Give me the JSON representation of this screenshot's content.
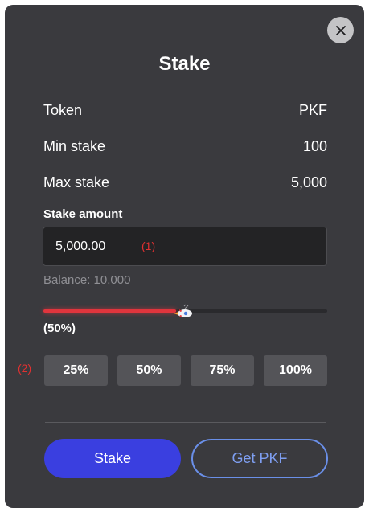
{
  "modal": {
    "title": "Stake",
    "close_icon": "close-icon"
  },
  "info": [
    {
      "label": "Token",
      "value": "PKF"
    },
    {
      "label": "Min stake",
      "value": "100"
    },
    {
      "label": "Max stake",
      "value": "5,000"
    }
  ],
  "stake_amount": {
    "label": "Stake amount",
    "value": "5,000.00",
    "annotation": "(1)"
  },
  "balance": "Balance: 10,000",
  "slider": {
    "fraction": 0.5,
    "readout": "(50%)",
    "thumb_icon": "rocket-icon",
    "fill_color": "#e0353d"
  },
  "percent_buttons": {
    "annotation": "(2)",
    "items": [
      "25%",
      "50%",
      "75%",
      "100%"
    ]
  },
  "actions": {
    "stake_label": "Stake",
    "get_label": "Get PKF"
  },
  "colors": {
    "modal_bg": "#3a3a3e",
    "primary": "#3a3fe0",
    "outline": "#6a8fe8",
    "annotation": "#e03131"
  }
}
